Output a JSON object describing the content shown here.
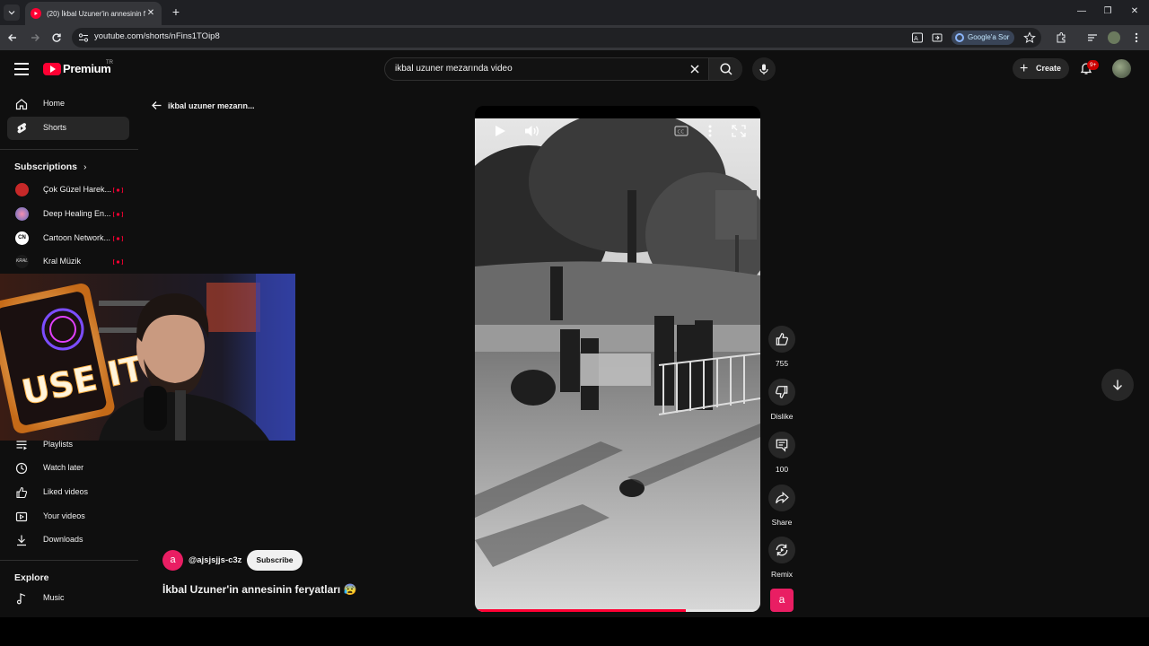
{
  "browser": {
    "tab_title": "(20) İkbal Uzuner'in annesinin f",
    "url": "youtube.com/shorts/nFins1TOip8",
    "google_sor_label": "Google'a Sor"
  },
  "youtube": {
    "logo_text": "Premium",
    "country_code": "TR",
    "search_query": "ikbal uzuner mezarında video",
    "create_label": "Create",
    "notification_badge": "9+"
  },
  "sidebar": {
    "main": [
      {
        "label": "Home",
        "icon": "home-icon"
      },
      {
        "label": "Shorts",
        "icon": "shorts-icon",
        "active": true
      }
    ],
    "subscriptions_heading": "Subscriptions",
    "subscriptions": [
      {
        "label": "Çok Güzel Harek...",
        "color": "#c62828"
      },
      {
        "label": "Deep Healing En...",
        "color": "#5c6bc0"
      },
      {
        "label": "Cartoon Network...",
        "color": "#222222"
      },
      {
        "label": "Kral Müzik",
        "color": "#1a1a1a"
      }
    ],
    "you_items": [
      {
        "label": "Playlists",
        "icon": "playlist-icon"
      },
      {
        "label": "Watch later",
        "icon": "clock-icon"
      },
      {
        "label": "Liked videos",
        "icon": "like-icon"
      },
      {
        "label": "Your videos",
        "icon": "video-icon"
      },
      {
        "label": "Downloads",
        "icon": "download-icon"
      }
    ],
    "explore_heading": "Explore",
    "explore_items": [
      {
        "label": "Music",
        "icon": "music-icon"
      }
    ]
  },
  "webcam_overlay": {
    "sign_text": "USE IT!"
  },
  "shorts": {
    "back_label": "ikbal uzuner mezarın...",
    "progress": 0.74,
    "actions": {
      "like_count": "755",
      "dislike_label": "Dislike",
      "comment_count": "100",
      "share_label": "Share",
      "remix_label": "Remix"
    },
    "channel_initial": "a",
    "channel_handle": "@ajsjsjjs-c3z",
    "subscribe_label": "Subscribe",
    "title": "İkbal Uzuner'in annesinin feryatları 😰"
  },
  "colors": {
    "accent": "#ff0033",
    "channel_avatar": "#e91e63"
  }
}
